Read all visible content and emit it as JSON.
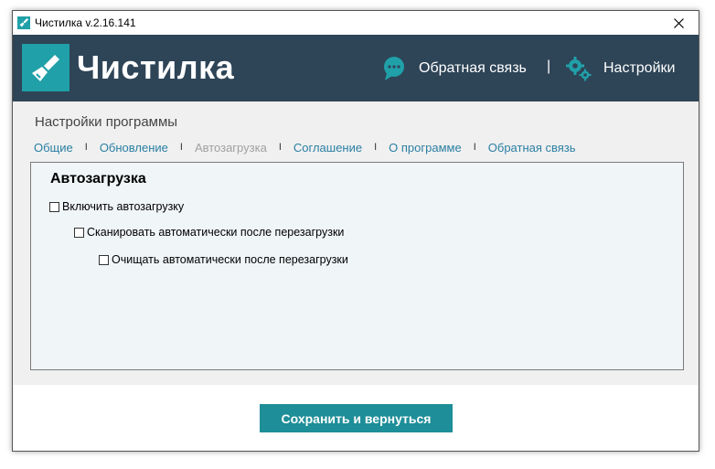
{
  "window": {
    "title": "Чистилка v.2.16.141",
    "close_symbol": "✕"
  },
  "header": {
    "brand": "Чистилка",
    "feedback_label": "Обратная связь",
    "separator": "|",
    "settings_label": "Настройки"
  },
  "page": {
    "title": "Настройки программы"
  },
  "tabs": [
    {
      "label": "Общие",
      "active": false
    },
    {
      "label": "Обновление",
      "active": false
    },
    {
      "label": "Автозагрузка",
      "active": true
    },
    {
      "label": "Соглашение",
      "active": false
    },
    {
      "label": "О программе",
      "active": false
    },
    {
      "label": "Обратная связь",
      "active": false
    }
  ],
  "tab_separator": "I",
  "panel": {
    "title": "Автозагрузка",
    "options": [
      {
        "label": "Включить автозагрузку",
        "checked": false
      },
      {
        "label": "Сканировать автоматически после перезагрузки",
        "checked": false
      },
      {
        "label": "Очищать автоматически после перезагрузки",
        "checked": false
      }
    ]
  },
  "footer": {
    "save_label": "Сохранить и вернуться"
  },
  "colors": {
    "header_bg": "#2e4457",
    "accent": "#20a0a8",
    "link": "#2b7fa3",
    "button": "#1e8e98"
  },
  "icons": {
    "app": "broom-icon",
    "feedback": "chat-bubble-icon",
    "settings": "gears-icon",
    "close": "close-icon"
  }
}
